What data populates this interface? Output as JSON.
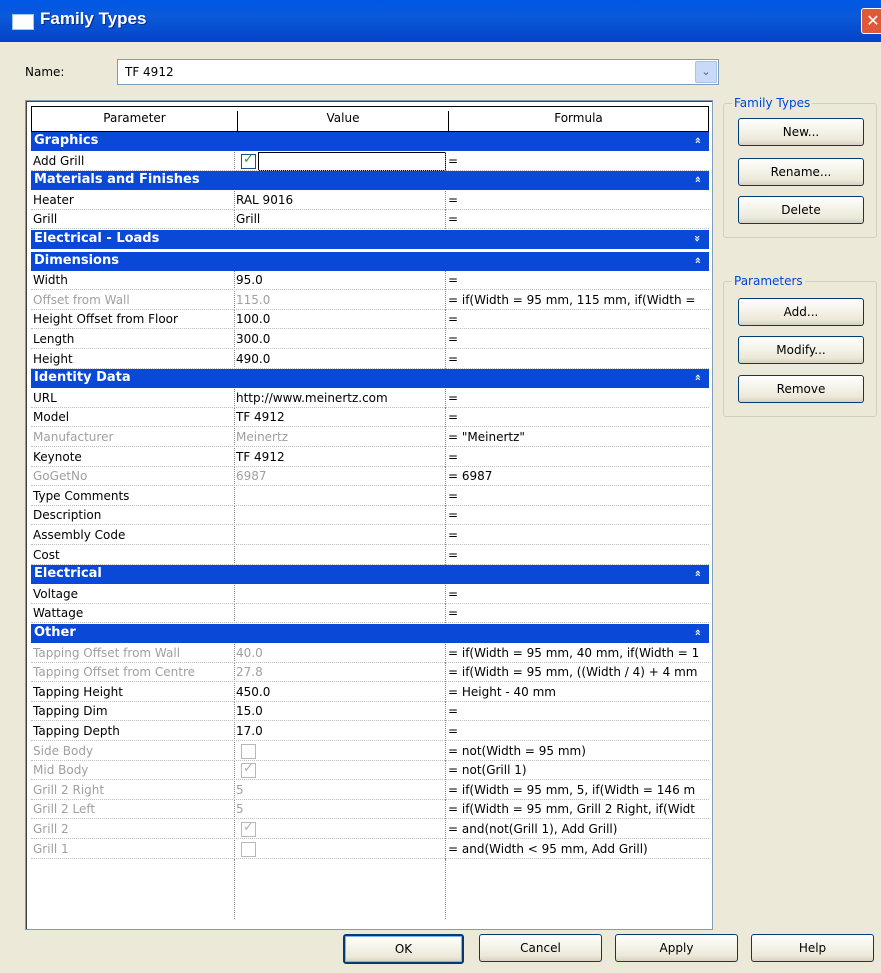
{
  "window": {
    "title": "Family Types",
    "close_glyph": "✕"
  },
  "name_field": {
    "label": "Name:",
    "value": "TF 4912"
  },
  "grid": {
    "headers": [
      "Parameter",
      "Value",
      "Formula"
    ],
    "groups": [
      {
        "title": "Graphics",
        "icon": "collapse-icon",
        "rows": [
          {
            "param": "Add Grill",
            "value": "",
            "formula": "=",
            "checkbox": true,
            "checked": true,
            "disabled": false,
            "editing": true
          }
        ]
      },
      {
        "title": "Materials and Finishes",
        "icon": "collapse-icon",
        "rows": [
          {
            "param": "Heater",
            "value": "RAL 9016",
            "formula": "="
          },
          {
            "param": "Grill",
            "value": "Grill",
            "formula": "="
          }
        ]
      },
      {
        "title": "Electrical - Loads",
        "icon": "expand-icon",
        "rows": []
      },
      {
        "title": "Dimensions",
        "icon": "collapse-icon",
        "rows": [
          {
            "param": "Width",
            "value": "95.0",
            "formula": "="
          },
          {
            "param": "Offset from Wall",
            "value": "115.0",
            "formula": "= if(Width = 95 mm, 115 mm, if(Width =",
            "disabled": true
          },
          {
            "param": "Height Offset from Floor",
            "value": "100.0",
            "formula": "="
          },
          {
            "param": "Length",
            "value": "300.0",
            "formula": "="
          },
          {
            "param": "Height",
            "value": "490.0",
            "formula": "="
          }
        ]
      },
      {
        "title": "Identity Data",
        "icon": "collapse-icon",
        "rows": [
          {
            "param": "URL",
            "value": "http://www.meinertz.com",
            "formula": "="
          },
          {
            "param": "Model",
            "value": "TF 4912",
            "formula": "="
          },
          {
            "param": "Manufacturer",
            "value": "Meinertz",
            "formula": "= \"Meinertz\"",
            "disabled": true
          },
          {
            "param": "Keynote",
            "value": "TF 4912",
            "formula": "="
          },
          {
            "param": "GoGetNo",
            "value": "6987",
            "formula": "= 6987",
            "disabled": true
          },
          {
            "param": "Type Comments",
            "value": "",
            "formula": "="
          },
          {
            "param": "Description",
            "value": "",
            "formula": "="
          },
          {
            "param": "Assembly Code",
            "value": "",
            "formula": "="
          },
          {
            "param": "Cost",
            "value": "",
            "formula": "="
          }
        ]
      },
      {
        "title": "Electrical",
        "icon": "collapse-icon",
        "rows": [
          {
            "param": "Voltage",
            "value": "",
            "formula": "="
          },
          {
            "param": "Wattage",
            "value": "",
            "formula": "="
          }
        ]
      },
      {
        "title": "Other",
        "icon": "collapse-icon",
        "rows": [
          {
            "param": "Tapping Offset from Wall",
            "value": "40.0",
            "formula": "= if(Width = 95 mm, 40 mm, if(Width = 1",
            "disabled": true
          },
          {
            "param": "Tapping Offset from Centre",
            "value": "27.8",
            "formula": "= if(Width = 95 mm, ((Width / 4) + 4 mm",
            "disabled": true
          },
          {
            "param": "Tapping Height",
            "value": "450.0",
            "formula": "= Height - 40 mm"
          },
          {
            "param": "Tapping Dim",
            "value": "15.0",
            "formula": "="
          },
          {
            "param": "Tapping Depth",
            "value": "17.0",
            "formula": "="
          },
          {
            "param": "Side Body",
            "value": "",
            "formula": "= not(Width = 95 mm)",
            "disabled": true,
            "checkbox": true,
            "checked": false
          },
          {
            "param": "Mid Body",
            "value": "",
            "formula": "= not(Grill 1)",
            "disabled": true,
            "checkbox": true,
            "checked": true
          },
          {
            "param": "Grill 2 Right",
            "value": "5",
            "formula": "= if(Width = 95 mm, 5, if(Width = 146 m",
            "disabled": true
          },
          {
            "param": "Grill 2 Left",
            "value": "5",
            "formula": "= if(Width = 95 mm, Grill 2 Right, if(Widt",
            "disabled": true
          },
          {
            "param": "Grill 2",
            "value": "",
            "formula": "= and(not(Grill 1), Add Grill)",
            "disabled": true,
            "checkbox": true,
            "checked": true
          },
          {
            "param": "Grill 1",
            "value": "",
            "formula": "= and(Width < 95 mm, Add Grill)",
            "disabled": true,
            "checkbox": true,
            "checked": false
          }
        ]
      }
    ]
  },
  "family_types_panel": {
    "legend": "Family Types",
    "buttons": [
      "New...",
      "Rename...",
      "Delete"
    ]
  },
  "parameters_panel": {
    "legend": "Parameters",
    "buttons": [
      "Add...",
      "Modify...",
      "Remove"
    ]
  },
  "footer": {
    "ok": "OK",
    "cancel": "Cancel",
    "apply": "Apply",
    "help": "Help"
  },
  "glyphs": {
    "check": "✓",
    "collapse": "»",
    "combo_arrow": "⌄"
  }
}
